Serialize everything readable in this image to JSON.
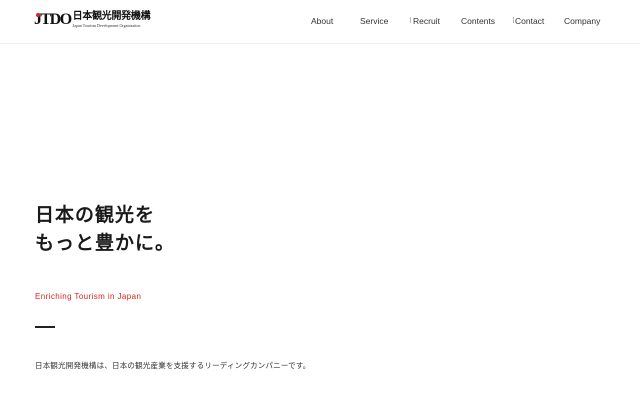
{
  "header": {
    "logo": {
      "mark": "JTDO",
      "name_jp": "日本観光開発機構",
      "name_en": "Japan Tourism Development Organization"
    },
    "nav": [
      {
        "label": "About"
      },
      {
        "label": "Service"
      },
      {
        "label": "Recruit"
      },
      {
        "label": "Contents"
      },
      {
        "label": "Contact"
      },
      {
        "label": "Company"
      }
    ]
  },
  "hero": {
    "headline_line1": "日本の観光を",
    "headline_line2": "もっと豊かに。",
    "tagline": "Enriching Tourism in Japan",
    "description": "日本観光開発機構は、日本の観光産業を支援するリーディングカンパニーです。"
  },
  "colors": {
    "accent": "#d7261e",
    "text": "#1a1a1a",
    "background": "#ffffff"
  }
}
